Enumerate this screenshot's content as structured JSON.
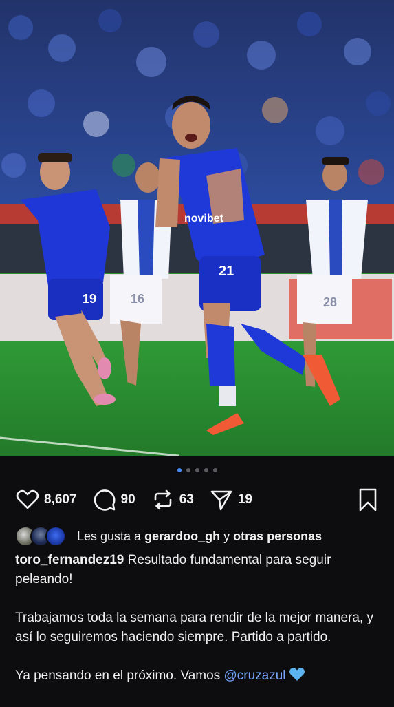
{
  "photo": {
    "description_icon": "photo",
    "player_number_front": "21",
    "sponsor_text": "novibet",
    "left_player_number": "19",
    "bg_player_number_1": "16",
    "bg_player_number_2": "28"
  },
  "carousel": {
    "total": 5,
    "active_index": 0
  },
  "actions": {
    "likes": "8,607",
    "comments": "90",
    "reposts": "63",
    "shares": "19"
  },
  "liked_by": {
    "prefix": "Les gusta a",
    "user": "gerardoo_gh",
    "joiner": "y",
    "others": "otras personas"
  },
  "caption": {
    "username": "toro_fernandez19",
    "line1": "Resultado fundamental para seguir peleando!",
    "line2": "Trabajamos toda la semana para rendir de la mejor manera, y así lo seguiremos haciendo siempre. Partido a partido.",
    "line3_text": "Ya pensando en el próximo. Vamos",
    "mention": "@cruzazul"
  },
  "colors": {
    "background": "#0d0d0f",
    "accent_dot": "#4b8cf5",
    "mention": "#7aa8ff",
    "heart_emoji": "#5bb4f0"
  }
}
